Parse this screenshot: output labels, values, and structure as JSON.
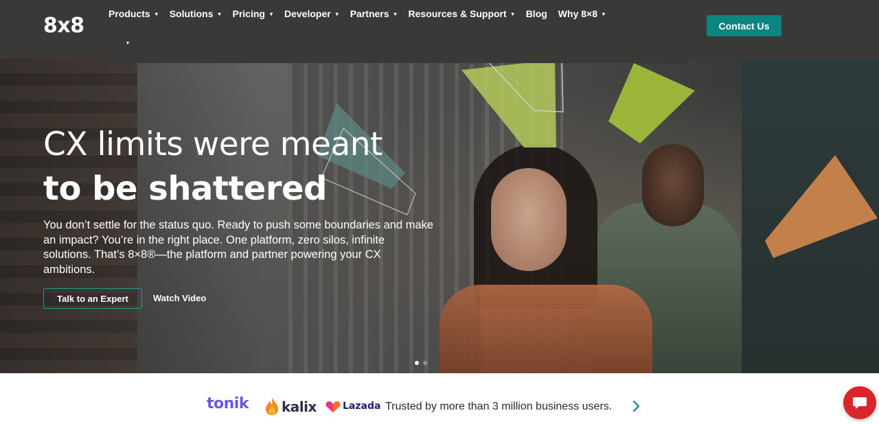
{
  "brand": {
    "logo": "8x8",
    "accent": "#0c8482",
    "header_bg": "#3a3938"
  },
  "nav": {
    "items": [
      {
        "label": "Products",
        "caret": true
      },
      {
        "label": "Solutions",
        "caret": true
      },
      {
        "label": "Pricing",
        "caret": true
      },
      {
        "label": "Developer",
        "caret": true
      },
      {
        "label": "Partners",
        "caret": true
      },
      {
        "label": "Resources & Support",
        "caret": true
      },
      {
        "label": "Blog",
        "caret": false
      },
      {
        "label": "Why 8×8",
        "caret": true
      }
    ],
    "caret_glyph": "▾",
    "overflow_glyph": "▾",
    "contact_label": "Contact Us"
  },
  "hero": {
    "title_line1": "CX limits were meant",
    "title_line2": "to be shattered",
    "body": "You don’t settle for the status quo. Ready to push some boundaries and make an impact? You’re in the right place. One platform, zero silos, infinite solutions. That’s 8×8®—the platform and partner powering your CX ambitions.",
    "cta_primary": "Talk to an Expert",
    "cta_secondary": "Watch Video",
    "slides": {
      "count": 2,
      "active": 1
    }
  },
  "trust": {
    "logos": [
      "tonik",
      "kalix",
      "Lazada"
    ],
    "text": "Trusted by more than 3 million business users."
  },
  "chat": {
    "icon": "chat-bubble-icon",
    "color": "#d8262b"
  }
}
